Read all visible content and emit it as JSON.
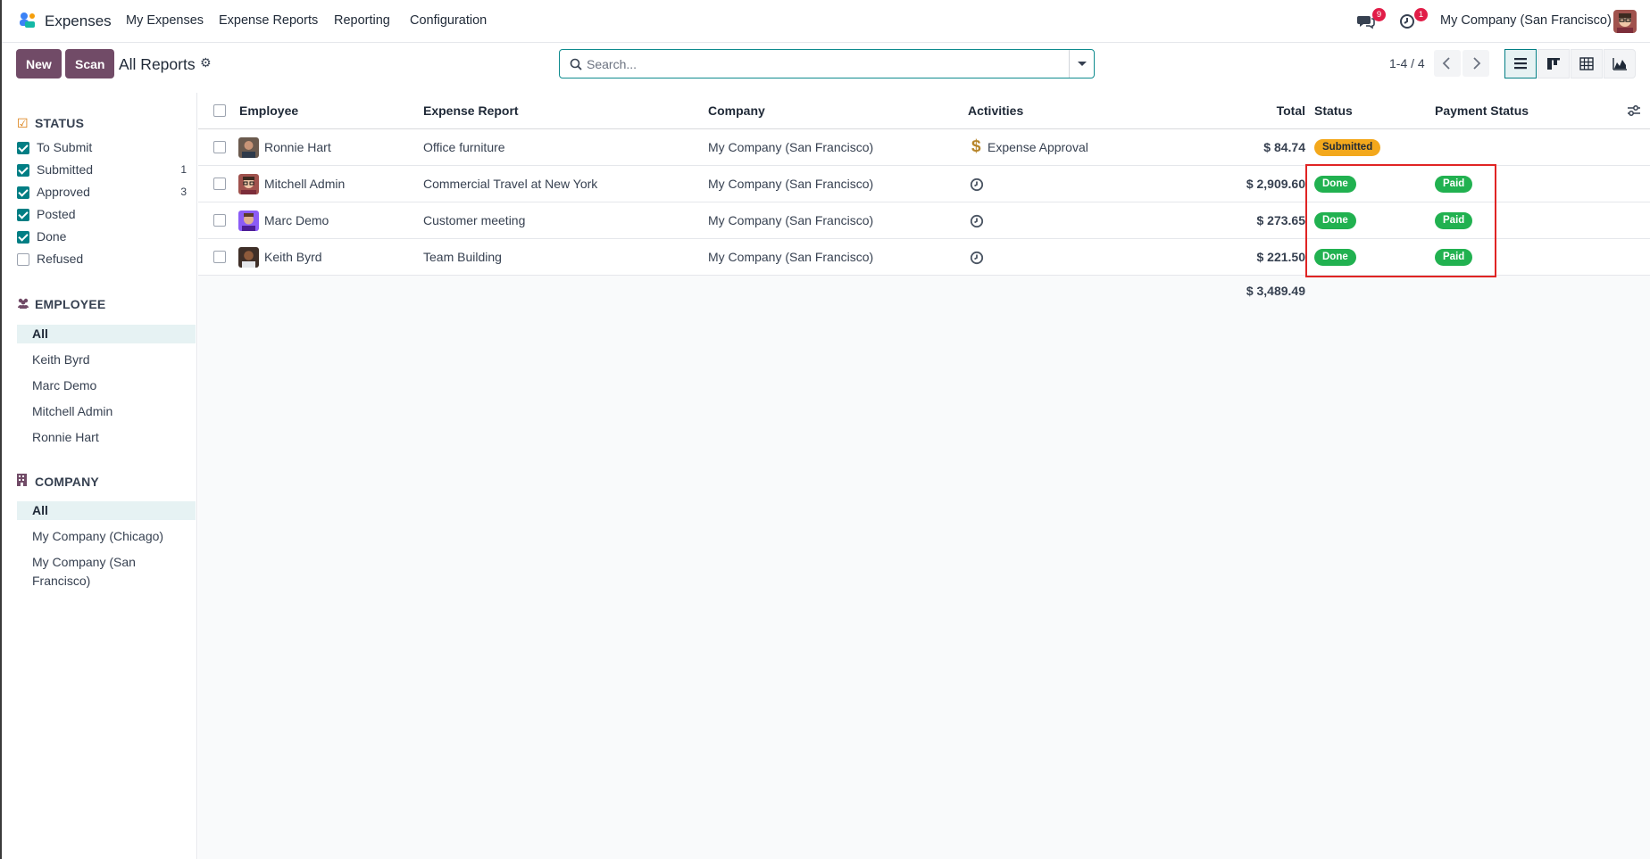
{
  "navbar": {
    "app_name": "Expenses",
    "menus": [
      "My Expenses",
      "Expense Reports",
      "Reporting",
      "Configuration"
    ],
    "messages_badge": "9",
    "activities_badge": "1",
    "company": "My Company (San Francisco)"
  },
  "control_panel": {
    "new_label": "New",
    "scan_label": "Scan",
    "title": "All Reports",
    "search_placeholder": "Search...",
    "pager": "1-4 / 4",
    "views": [
      "list-icon",
      "kanban-icon",
      "pivot-icon",
      "graph-icon"
    ]
  },
  "sidepanel": {
    "status": {
      "title": "STATUS",
      "items": [
        {
          "label": "To Submit",
          "checked": true,
          "count": ""
        },
        {
          "label": "Submitted",
          "checked": true,
          "count": "1"
        },
        {
          "label": "Approved",
          "checked": true,
          "count": "3"
        },
        {
          "label": "Posted",
          "checked": true,
          "count": ""
        },
        {
          "label": "Done",
          "checked": true,
          "count": ""
        },
        {
          "label": "Refused",
          "checked": false,
          "count": ""
        }
      ]
    },
    "employee": {
      "title": "EMPLOYEE",
      "items": [
        "All",
        "Keith Byrd",
        "Marc Demo",
        "Mitchell Admin",
        "Ronnie Hart"
      ]
    },
    "company": {
      "title": "COMPANY",
      "items": [
        "All",
        "My Company (Chicago)",
        "My Company (San Francisco)"
      ]
    }
  },
  "table": {
    "columns": [
      "Employee",
      "Expense Report",
      "Company",
      "Activities",
      "Total",
      "Status",
      "Payment Status"
    ],
    "rows": [
      {
        "employee": "Ronnie Hart",
        "report": "Office furniture",
        "company": "My Company (San Francisco)",
        "activity": "Expense Approval",
        "total": "$ 84.74",
        "status": "Submitted",
        "payment": ""
      },
      {
        "employee": "Mitchell Admin",
        "report": "Commercial Travel at New York",
        "company": "My Company (San Francisco)",
        "activity": "",
        "total": "$ 2,909.60",
        "status": "Done",
        "payment": "Paid"
      },
      {
        "employee": "Marc Demo",
        "report": "Customer meeting",
        "company": "My Company (San Francisco)",
        "activity": "",
        "total": "$ 273.65",
        "status": "Done",
        "payment": "Paid"
      },
      {
        "employee": "Keith Byrd",
        "report": "Team Building",
        "company": "My Company (San Francisco)",
        "activity": "",
        "total": "$ 221.50",
        "status": "Done",
        "payment": "Paid"
      }
    ],
    "grand_total": "$ 3,489.49"
  },
  "colors": {
    "brand": "#714b67",
    "accent": "#017e84",
    "done": "#21b150",
    "submitted": "#f3a81c",
    "highlight": "#e02424"
  }
}
